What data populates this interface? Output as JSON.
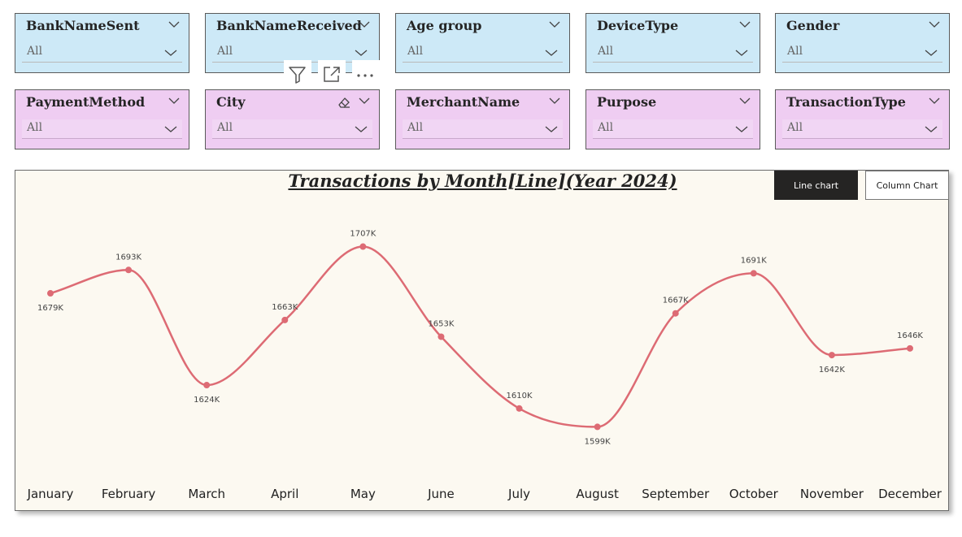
{
  "slicers": [
    {
      "id": "bank-name-sent",
      "title": "BankNameSent",
      "value": "All",
      "color": "blue"
    },
    {
      "id": "bank-name-received",
      "title": "BankNameReceived",
      "value": "All",
      "color": "blue"
    },
    {
      "id": "age-group",
      "title": "Age group",
      "value": "All",
      "color": "blue"
    },
    {
      "id": "device-type",
      "title": "DeviceType",
      "value": "All",
      "color": "blue"
    },
    {
      "id": "gender",
      "title": "Gender",
      "value": "All",
      "color": "blue"
    },
    {
      "id": "payment-method",
      "title": "PaymentMethod",
      "value": "All",
      "color": "pink"
    },
    {
      "id": "city",
      "title": "City",
      "value": "All",
      "color": "pink"
    },
    {
      "id": "merchant-name",
      "title": "MerchantName",
      "value": "All",
      "color": "pink"
    },
    {
      "id": "purpose",
      "title": "Purpose",
      "value": "All",
      "color": "pink"
    },
    {
      "id": "transaction-type",
      "title": "TransactionType",
      "value": "All",
      "color": "pink"
    }
  ],
  "visual_header": {
    "icons": [
      "filter-icon",
      "focus-mode-icon",
      "more-options-icon"
    ]
  },
  "toggle": {
    "line_label": "Line chart",
    "column_label": "Column Chart",
    "active": "line"
  },
  "colors": {
    "slicer_blue": "#cde9f7",
    "slicer_pink": "#efcdf2",
    "line": "#dd6b74",
    "chart_bg": "#fcf9f1"
  },
  "chart_data": {
    "type": "line",
    "title": "Transactions by Month[Line](Year 2024)",
    "categories": [
      "January",
      "February",
      "March",
      "April",
      "May",
      "June",
      "July",
      "August",
      "September",
      "October",
      "November",
      "December"
    ],
    "series": [
      {
        "values": [
          1679,
          1693,
          1624,
          1663,
          1707,
          1653,
          1610,
          1599,
          1667,
          1691,
          1642,
          1646
        ],
        "labels": [
          "1679K",
          "1693K",
          "1624K",
          "1663K",
          "1707K",
          "1653K",
          "1610K",
          "1599K",
          "1667K",
          "1691K",
          "1642K",
          "1646K"
        ]
      }
    ],
    "ylim": [
      1588,
      1717
    ],
    "xlabel": "",
    "ylabel": "",
    "grid": false,
    "smooth": true
  }
}
